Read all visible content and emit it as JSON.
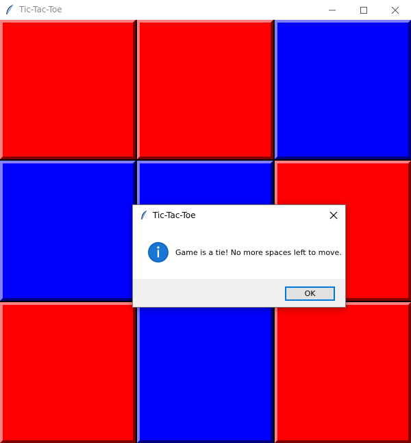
{
  "window": {
    "title": "Tic-Tac-Toe",
    "controls": [
      "minimize",
      "maximize",
      "close"
    ]
  },
  "board": {
    "colors": {
      "red": "#ff0000",
      "blue": "#0000ff"
    },
    "cells": [
      [
        "red",
        "red",
        "blue"
      ],
      [
        "blue",
        "blue",
        "red"
      ],
      [
        "red",
        "blue",
        "red"
      ]
    ]
  },
  "dialog": {
    "title": "Tic-Tac-Toe",
    "icon": "info-icon",
    "message": "Game is a tie! No more spaces left to move.",
    "ok_label": "OK",
    "accent": "#0078d7"
  }
}
